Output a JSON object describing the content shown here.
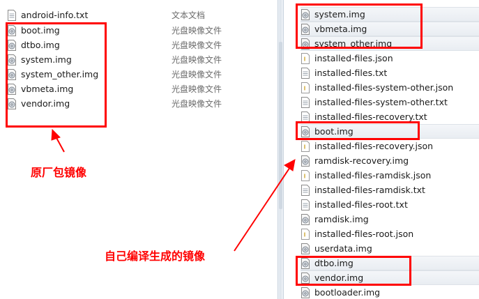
{
  "left_pane": {
    "files": [
      {
        "name": "android-info.txt",
        "type": "文本文档",
        "icon": "text-file-icon"
      },
      {
        "name": "boot.img",
        "type": "光盘映像文件",
        "icon": "disc-image-icon"
      },
      {
        "name": "dtbo.img",
        "type": "光盘映像文件",
        "icon": "disc-image-icon"
      },
      {
        "name": "system.img",
        "type": "光盘映像文件",
        "icon": "disc-image-icon"
      },
      {
        "name": "system_other.img",
        "type": "光盘映像文件",
        "icon": "disc-image-icon"
      },
      {
        "name": "vbmeta.img",
        "type": "光盘映像文件",
        "icon": "disc-image-icon"
      },
      {
        "name": "vendor.img",
        "type": "光盘映像文件",
        "icon": "disc-image-icon"
      }
    ]
  },
  "right_pane": {
    "files": [
      {
        "name": "system.img",
        "icon": "disc-image-icon"
      },
      {
        "name": "vbmeta.img",
        "icon": "disc-image-icon"
      },
      {
        "name": "system_other.img",
        "icon": "disc-image-icon"
      },
      {
        "name": "installed-files.json",
        "icon": "json-file-icon"
      },
      {
        "name": "installed-files.txt",
        "icon": "text-file-icon"
      },
      {
        "name": "installed-files-system-other.json",
        "icon": "json-file-icon"
      },
      {
        "name": "installed-files-system-other.txt",
        "icon": "text-file-icon"
      },
      {
        "name": "installed-files-recovery.txt",
        "icon": "text-file-icon"
      },
      {
        "name": "boot.img",
        "icon": "disc-image-icon"
      },
      {
        "name": "installed-files-recovery.json",
        "icon": "json-file-icon"
      },
      {
        "name": "ramdisk-recovery.img",
        "icon": "disc-image-icon"
      },
      {
        "name": "installed-files-ramdisk.json",
        "icon": "json-file-icon"
      },
      {
        "name": "installed-files-ramdisk.txt",
        "icon": "text-file-icon"
      },
      {
        "name": "installed-files-root.txt",
        "icon": "text-file-icon"
      },
      {
        "name": "ramdisk.img",
        "icon": "disc-image-icon"
      },
      {
        "name": "installed-files-root.json",
        "icon": "json-file-icon"
      },
      {
        "name": "userdata.img",
        "icon": "disc-image-icon"
      },
      {
        "name": "dtbo.img",
        "icon": "disc-image-icon"
      },
      {
        "name": "vendor.img",
        "icon": "disc-image-icon"
      },
      {
        "name": "bootloader.img",
        "icon": "disc-image-icon"
      }
    ]
  },
  "annotations": {
    "original_label": "原厂包镜像",
    "built_label": "自己编译生成的镜像",
    "color": "#ff0000"
  }
}
